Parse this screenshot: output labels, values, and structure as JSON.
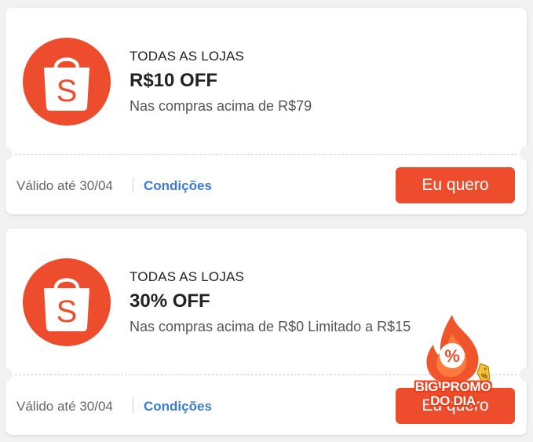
{
  "brand": {
    "accent": "#ee4d2d",
    "link_color": "#3b7bd6",
    "logo_letter": "S",
    "logo_icon": "shopee-bag-icon"
  },
  "coupons": [
    {
      "store": "TODAS AS LOJAS",
      "title": "R$10 OFF",
      "condition": "Nas compras acima de R$79",
      "valid": "Válido até 30/04",
      "conditions_link": "Condições",
      "cta": "Eu quero"
    },
    {
      "store": "TODAS AS LOJAS",
      "title": "30% OFF",
      "condition": "Nas compras acima de R$0 Limitado a R$15",
      "valid": "Válido até 30/04",
      "conditions_link": "Condições",
      "cta": "Eu quero"
    }
  ],
  "promo_badge": {
    "line1": "BIG PROMO",
    "line2": "DO DIA",
    "icon": "flame-percent-icon",
    "tag_icon": "percent-tag-icon",
    "tag_symbol": "%"
  }
}
